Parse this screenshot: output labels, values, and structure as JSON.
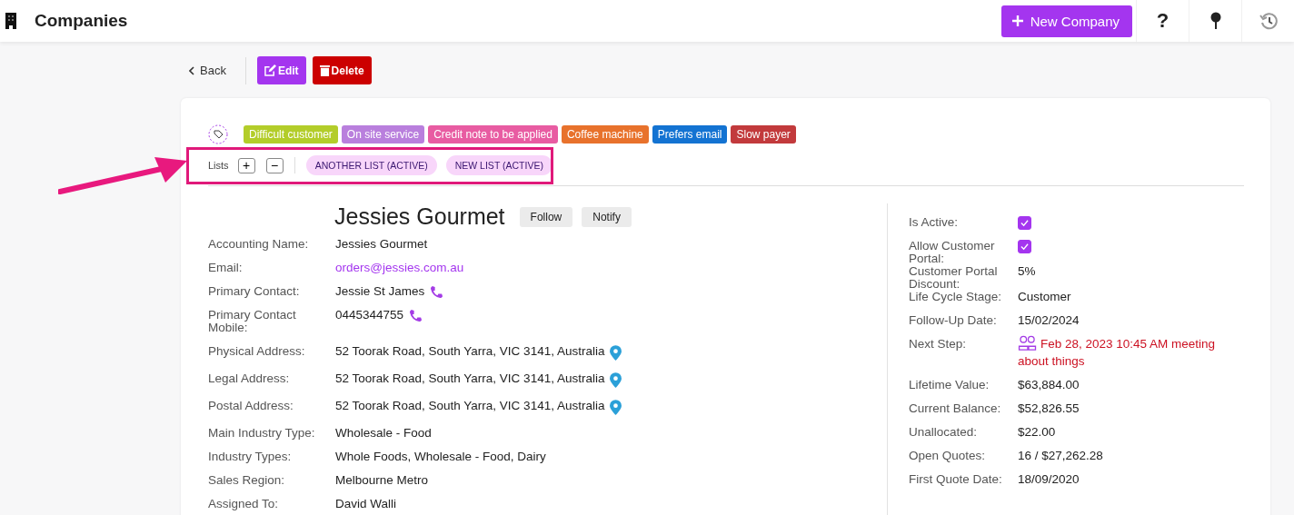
{
  "header": {
    "title": "Companies",
    "new_button": "New Company",
    "help": "?"
  },
  "actions": {
    "back": "Back",
    "edit": "Edit",
    "delete": "Delete"
  },
  "tags": [
    {
      "label": "Difficult customer",
      "color": "#b3cd2a"
    },
    {
      "label": "On site service",
      "color": "#b97fdd"
    },
    {
      "label": "Credit note to be applied",
      "color": "#e85ca2"
    },
    {
      "label": "Coffee machine",
      "color": "#e8722c"
    },
    {
      "label": "Prefers email",
      "color": "#1373d2"
    },
    {
      "label": "Slow payer",
      "color": "#c23a3c"
    }
  ],
  "lists": {
    "label": "Lists",
    "add": "+",
    "remove": "−",
    "items": [
      "ANOTHER LIST (ACTIVE)",
      "NEW LIST (ACTIVE)"
    ]
  },
  "company": {
    "name": "Jessies Gourmet",
    "follow": "Follow",
    "notify": "Notify"
  },
  "left": [
    {
      "label": "Accounting Name:",
      "value": "Jessies Gourmet",
      "kind": "text"
    },
    {
      "label": "Email:",
      "value": "orders@jessies.com.au",
      "kind": "link"
    },
    {
      "label": "Primary Contact:",
      "value": "Jessie St James",
      "kind": "phone"
    },
    {
      "label": "Primary Contact Mobile:",
      "value": "0445344755",
      "kind": "phone"
    },
    {
      "label": "Physical Address:",
      "value": "52 Toorak Road, South Yarra, VIC 3141, Australia",
      "kind": "address"
    },
    {
      "label": "Legal Address:",
      "value": "52 Toorak Road, South Yarra, VIC 3141, Australia",
      "kind": "address"
    },
    {
      "label": "Postal Address:",
      "value": "52 Toorak Road, South Yarra, VIC 3141, Australia",
      "kind": "address"
    },
    {
      "label": "Main Industry Type:",
      "value": "Wholesale - Food",
      "kind": "text"
    },
    {
      "label": "Industry Types:",
      "value": "Whole Foods, Wholesale - Food, Dairy",
      "kind": "text"
    },
    {
      "label": "Sales Region:",
      "value": "Melbourne Metro",
      "kind": "text"
    },
    {
      "label": "Assigned To:",
      "value": "David Walli",
      "kind": "text"
    }
  ],
  "right": [
    {
      "label": "Is Active:",
      "kind": "checkbox",
      "checked": true
    },
    {
      "label": "Allow Customer Portal:",
      "kind": "checkbox",
      "checked": true
    },
    {
      "label": "Customer Portal Discount:",
      "value": "5%",
      "kind": "text"
    },
    {
      "label": "Life Cycle Stage:",
      "value": "Customer",
      "kind": "text"
    },
    {
      "label": "Follow-Up Date:",
      "value": "15/02/2024",
      "kind": "text"
    },
    {
      "label": "Next Step:",
      "value": "Feb 28, 2023 10:45 AM meeting about things",
      "kind": "meeting"
    },
    {
      "label": "Lifetime Value:",
      "value": "$63,884.00",
      "kind": "text"
    },
    {
      "label": "Current Balance:",
      "value": "$52,826.55",
      "kind": "text"
    },
    {
      "label": "Unallocated:",
      "value": "$22.00",
      "kind": "text"
    },
    {
      "label": "Open Quotes:",
      "value": "16 / $27,262.28",
      "kind": "text"
    },
    {
      "label": "First Quote Date:",
      "value": "18/09/2020",
      "kind": "text"
    }
  ]
}
